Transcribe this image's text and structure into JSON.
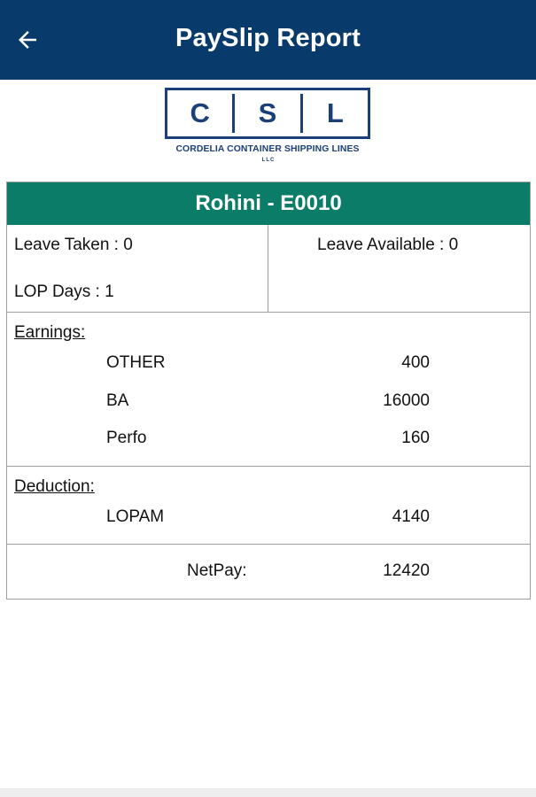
{
  "appbar": {
    "title": "PaySlip Report",
    "back_icon": "arrow-left-icon",
    "background": "#083a6b"
  },
  "logo": {
    "letters": [
      "C",
      "S",
      "L"
    ],
    "company_name": "CORDELIA CONTAINER SHIPPING LINES",
    "suffix": "LLC",
    "color": "#1b3f78"
  },
  "employee": {
    "header": "Rohini - E0010",
    "header_color": "#0b7c68"
  },
  "leave": {
    "leave_taken": "Leave Taken : 0",
    "leave_available": "Leave Available : 0",
    "lop_days": "LOP Days : 1"
  },
  "earnings": {
    "title": "Earnings:",
    "items": [
      {
        "label": "OTHER",
        "value": "400"
      },
      {
        "label": "BA",
        "value": "16000"
      },
      {
        "label": "Perfo",
        "value": "160"
      }
    ]
  },
  "deduction": {
    "title": "Deduction:",
    "items": [
      {
        "label": "LOPAM",
        "value": "4140"
      }
    ]
  },
  "netpay": {
    "label": "NetPay:",
    "value": "12420"
  }
}
